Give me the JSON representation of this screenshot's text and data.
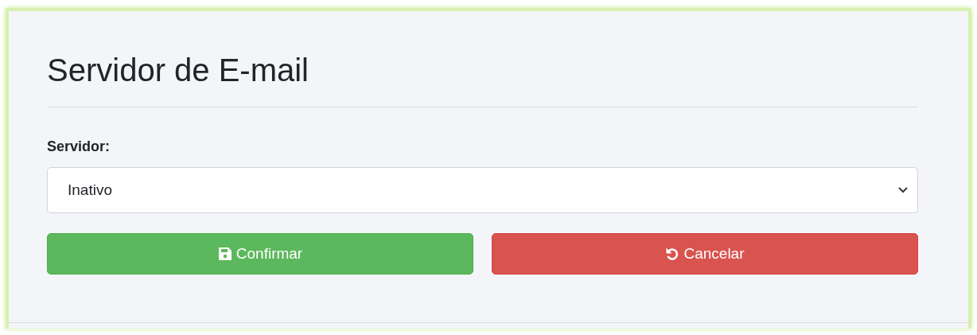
{
  "title": "Servidor de E-mail",
  "field": {
    "label": "Servidor:",
    "value": "Inativo"
  },
  "buttons": [
    {
      "kind": "confirm",
      "label": "Confirmar"
    },
    {
      "kind": "cancel",
      "label": "Cancelar"
    }
  ]
}
